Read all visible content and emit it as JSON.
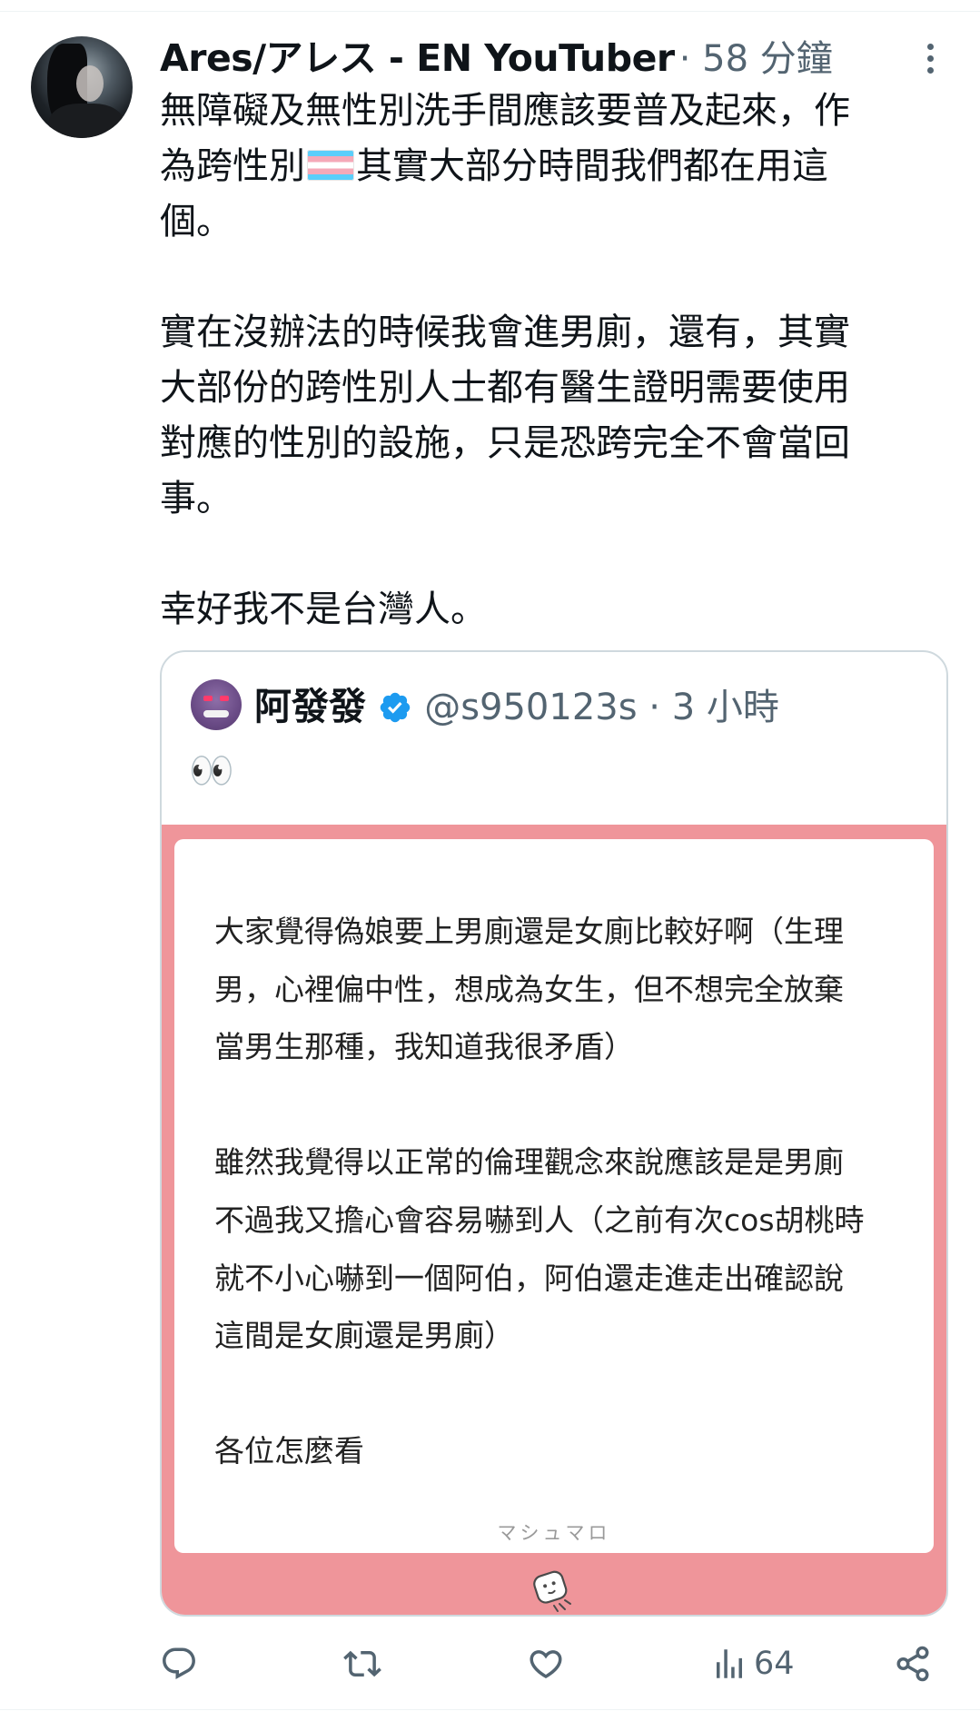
{
  "tweet": {
    "author": {
      "display_name": "Ares/アレス - EN YouTuber",
      "time": "· 58 分鐘"
    },
    "text_line_1": "無障礙及無性別洗手間應該要普及起來，作",
    "text_line_2_a": "為跨性別",
    "text_line_2_emoji": "trans-flag-emoji",
    "text_line_2_b": "其實大部分時間我們都在用這",
    "text_line_3": "個。",
    "paragraph_2": "實在沒辦法的時候我會進男廁，還有，其實\n大部份的跨性別人士都有醫生證明需要使用\n對應的性別的設施，只是恐跨完全不會當回\n事。",
    "paragraph_3": "幸好我不是台灣人。",
    "quoted": {
      "display_name": "阿發發",
      "handle_time": "@s950123s · 3 小時",
      "emoji": "👀",
      "verified_color": "#1d9bf0",
      "media": {
        "background_color": "#ef959a",
        "text": "大家覺得偽娘要上男廁還是女廁比較好啊（生理\n男，心裡偏中性，想成為女生，但不想完全放棄\n當男生那種，我知道我很矛盾）\n\n雖然我覺得以正常的倫理觀念來說應該是是男廁\n不過我又擔心會容易嚇到人（之前有次cos胡桃時\n就不小心嚇到一個阿伯，阿伯還走進走出確認說\n這間是女廁還是男廁）\n\n各位怎麼看",
        "footer": "マシュマロ",
        "logo_icon": "marshmallow-icon"
      }
    },
    "actions": {
      "reply_icon": "reply-icon",
      "retweet_icon": "retweet-icon",
      "like_icon": "heart-icon",
      "views_icon": "views-icon",
      "views_count": "64",
      "share_icon": "share-icon"
    }
  }
}
